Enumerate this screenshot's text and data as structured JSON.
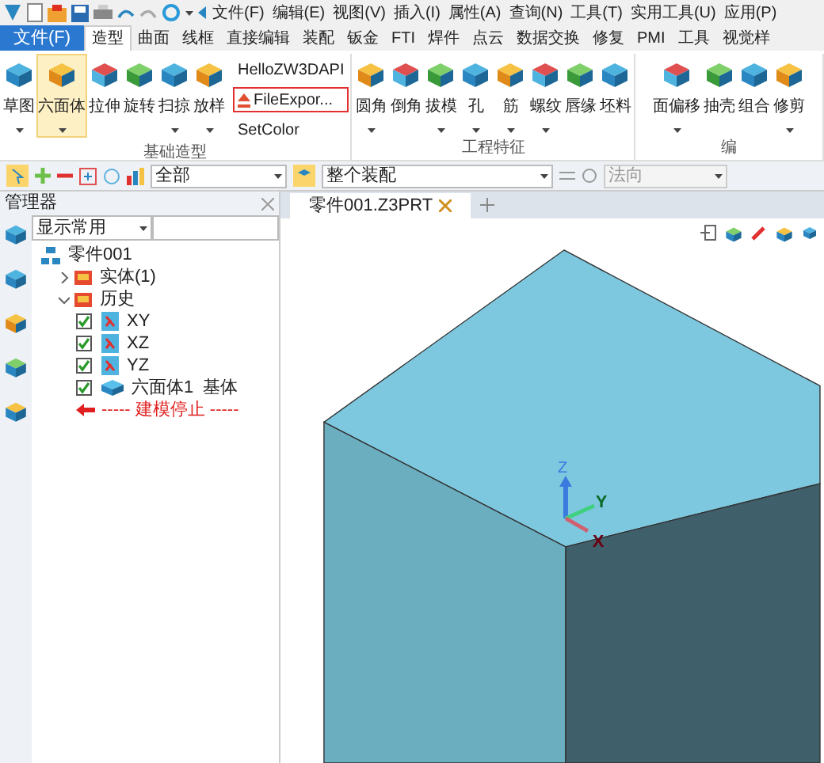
{
  "menu_bar": {
    "items": [
      "文件(F)",
      "编辑(E)",
      "视图(V)",
      "插入(I)",
      "属性(A)",
      "查询(N)",
      "工具(T)",
      "实用工具(U)",
      "应用(P)"
    ]
  },
  "ribbon_tabs": [
    {
      "label": "文件(F)",
      "kind": "file",
      "selected": false
    },
    {
      "label": "造型",
      "kind": "tab",
      "selected": true
    },
    {
      "label": "曲面",
      "kind": "tab",
      "selected": false
    },
    {
      "label": "线框",
      "kind": "tab",
      "selected": false
    },
    {
      "label": "直接编辑",
      "kind": "tab",
      "selected": false
    },
    {
      "label": "装配",
      "kind": "tab",
      "selected": false
    },
    {
      "label": "钣金",
      "kind": "tab",
      "selected": false
    },
    {
      "label": "FTI",
      "kind": "tab",
      "selected": false
    },
    {
      "label": "焊件",
      "kind": "tab",
      "selected": false
    },
    {
      "label": "点云",
      "kind": "tab",
      "selected": false
    },
    {
      "label": "数据交换",
      "kind": "tab",
      "selected": false
    },
    {
      "label": "修复",
      "kind": "tab",
      "selected": false
    },
    {
      "label": "PMI",
      "kind": "tab",
      "selected": false
    },
    {
      "label": "工具",
      "kind": "tab",
      "selected": false
    },
    {
      "label": "视觉样",
      "kind": "tab",
      "selected": false
    }
  ],
  "ribbon_groups": [
    {
      "label": "基础造型",
      "buttons": [
        {
          "label": "草图",
          "dropdown": true,
          "selected": false
        },
        {
          "label": "六面体",
          "dropdown": true,
          "selected": true
        },
        {
          "label": "拉伸",
          "dropdown": false,
          "selected": false
        },
        {
          "label": "旋转",
          "dropdown": false,
          "selected": false
        },
        {
          "label": "扫掠",
          "dropdown": true,
          "selected": false
        },
        {
          "label": "放样",
          "dropdown": true,
          "selected": false
        }
      ],
      "small_buttons": [
        {
          "label": "HelloZW3DAPI",
          "highlighted": false
        },
        {
          "label": "FileExpor...",
          "highlighted": true
        },
        {
          "label": "SetColor",
          "highlighted": false
        }
      ]
    },
    {
      "label": "工程特征",
      "buttons": [
        {
          "label": "圆角",
          "dropdown": true,
          "selected": false
        },
        {
          "label": "倒角",
          "dropdown": false,
          "selected": false
        },
        {
          "label": "拔模",
          "dropdown": true,
          "selected": false
        },
        {
          "label": "孔",
          "dropdown": true,
          "selected": false
        },
        {
          "label": "筋",
          "dropdown": true,
          "selected": false
        },
        {
          "label": "螺纹",
          "dropdown": true,
          "selected": false
        },
        {
          "label": "唇缘",
          "dropdown": false,
          "selected": false
        },
        {
          "label": "坯料",
          "dropdown": false,
          "selected": false
        }
      ]
    },
    {
      "label": "编",
      "buttons": [
        {
          "label": "面偏移",
          "dropdown": true,
          "selected": false
        },
        {
          "label": "抽壳",
          "dropdown": false,
          "selected": false
        },
        {
          "label": "组合",
          "dropdown": false,
          "selected": false
        },
        {
          "label": "修剪",
          "dropdown": true,
          "selected": false
        }
      ]
    }
  ],
  "toolbar": {
    "filter": "全部",
    "scope": "整个装配",
    "direction": "法向"
  },
  "manager": {
    "title": "管理器",
    "display_filter": "显示常用",
    "tree": [
      {
        "label": "零件001",
        "kind": "part",
        "children": [
          {
            "label": "实体(1)",
            "kind": "folder",
            "expanded": false
          },
          {
            "label": "历史",
            "kind": "folder",
            "expanded": true,
            "stop_marker": "----- 建模停止 -----",
            "children": [
              {
                "label": "XY",
                "kind": "plane",
                "checked": true
              },
              {
                "label": "XZ",
                "kind": "plane",
                "checked": true
              },
              {
                "label": "YZ",
                "kind": "plane",
                "checked": true
              },
              {
                "label": "六面体1  基体",
                "kind": "feature",
                "checked": true
              }
            ]
          }
        ]
      }
    ]
  },
  "viewport": {
    "tabs": [
      {
        "label": "零件001.Z3PRT",
        "selected": true
      }
    ],
    "axes": {
      "x": "X",
      "y": "Y",
      "z": "Z"
    }
  }
}
